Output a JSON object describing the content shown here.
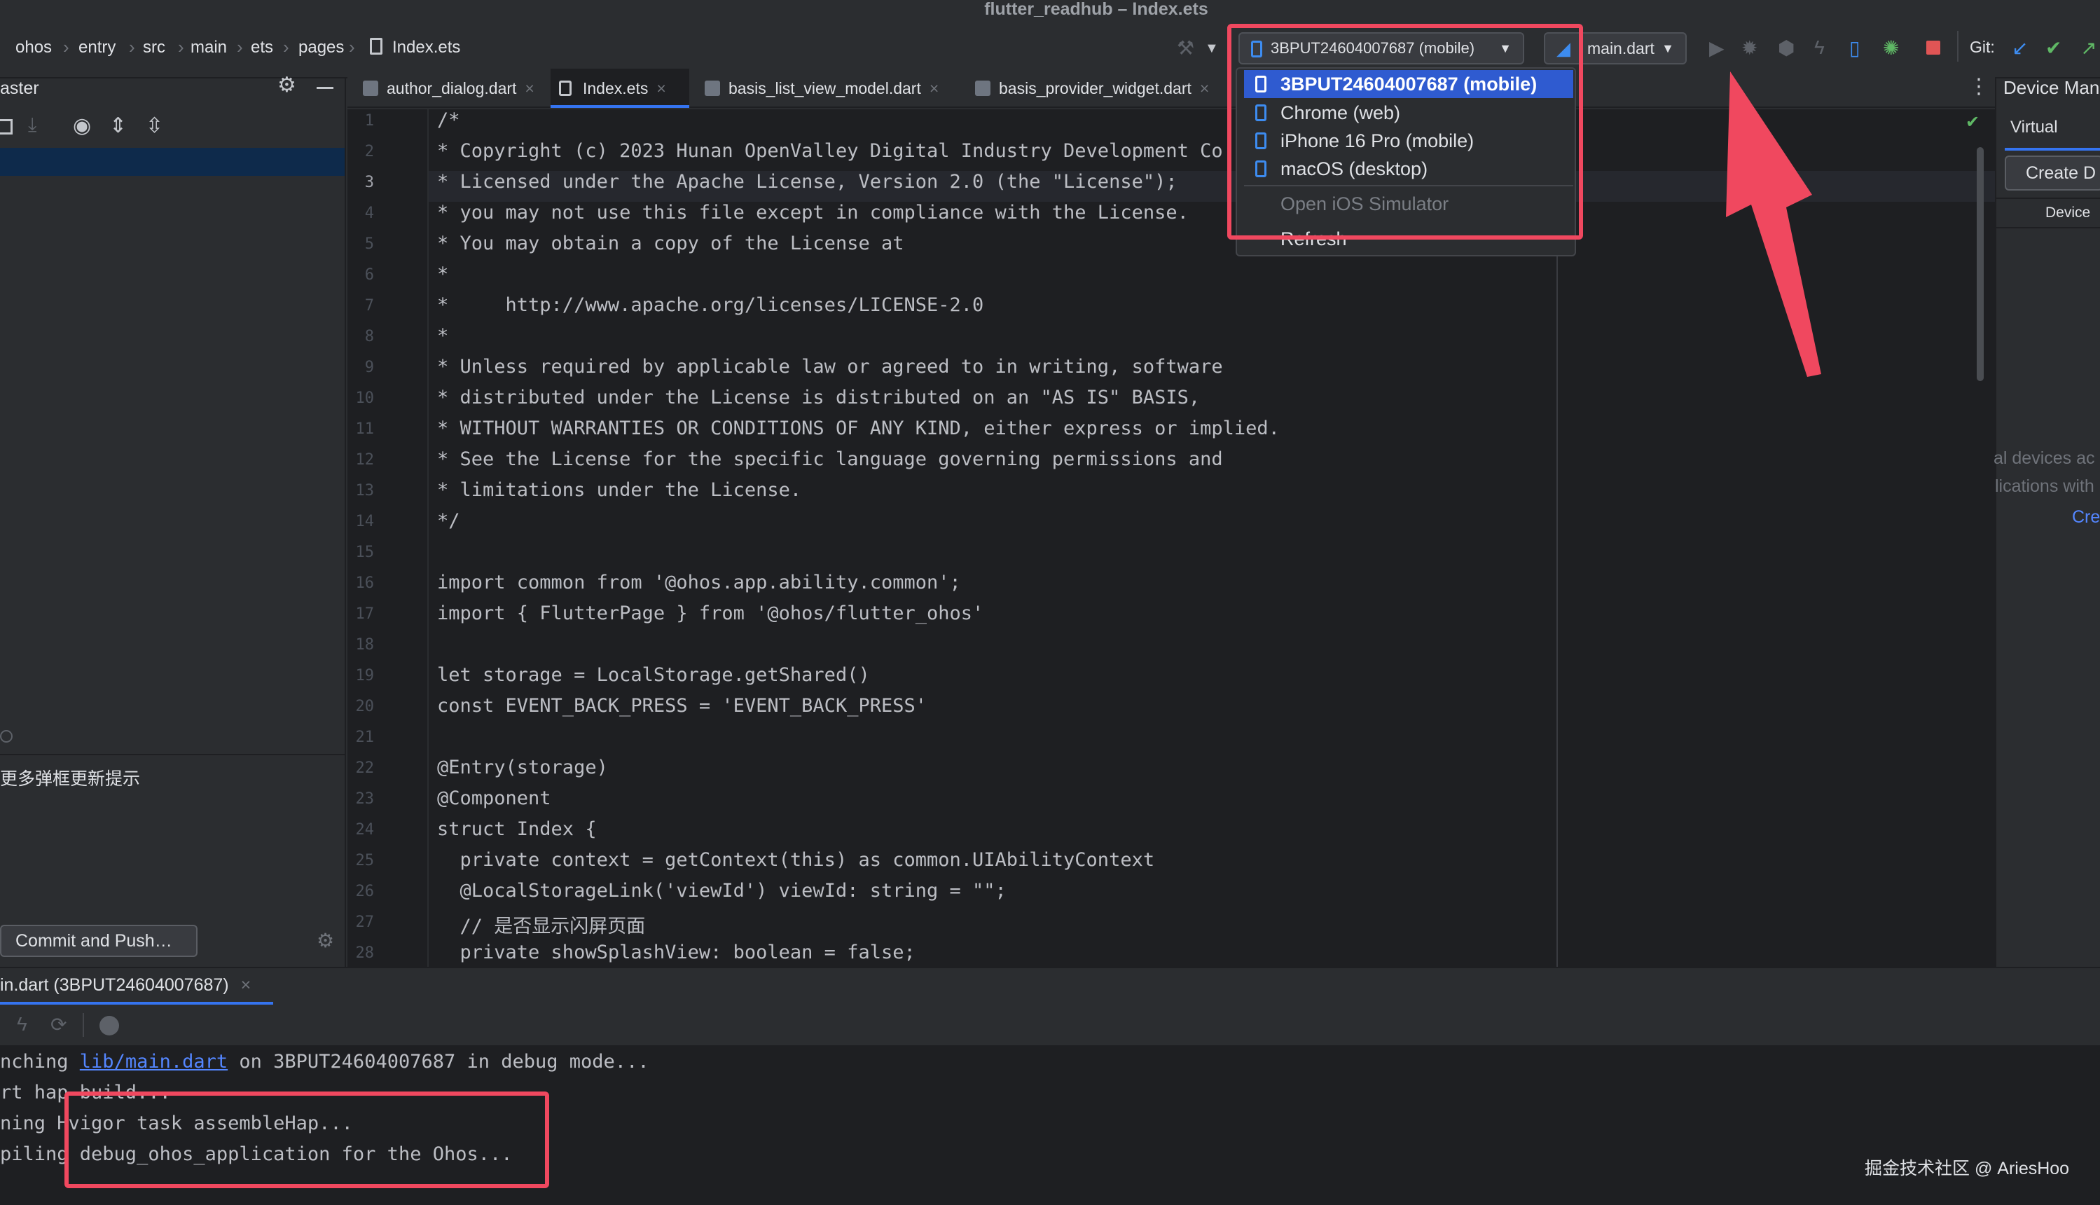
{
  "window": {
    "title": "flutter_readhub – Index.ets"
  },
  "breadcrumb": [
    "ohos",
    "entry",
    "src",
    "main",
    "ets",
    "pages",
    "Index.ets"
  ],
  "toolbar": {
    "device_selected": "3BPUT24604007687 (mobile)",
    "run_config": "main.dart",
    "git_label": "Git:"
  },
  "left_panel": {
    "branch_text": "aster",
    "commit_message_text": "更多弹框更新提示",
    "commit_button": "Commit and Push…"
  },
  "tabs": [
    {
      "label": "author_dialog.dart"
    },
    {
      "label": "Index.ets"
    },
    {
      "label": "basis_list_view_model.dart"
    },
    {
      "label": "basis_provider_widget.dart"
    }
  ],
  "device_menu": {
    "items": [
      "3BPUT24604007687 (mobile)",
      "Chrome (web)",
      "iPhone 16 Pro (mobile)",
      "macOS (desktop)"
    ],
    "open_simulator": "Open iOS Simulator",
    "refresh": "Refresh"
  },
  "editor": {
    "line_numbers": [
      "1",
      "2",
      "3",
      "4",
      "5",
      "6",
      "7",
      "8",
      "9",
      "10",
      "11",
      "12",
      "13",
      "14",
      "15",
      "16",
      "17",
      "18",
      "19",
      "20",
      "21",
      "22",
      "23",
      "24",
      "25",
      "26",
      "27",
      "28"
    ],
    "lines": [
      "/*",
      "* Copyright (c) 2023 Hunan OpenValley Digital Industry Development Co.,",
      "* Licensed under the Apache License, Version 2.0 (the \"License\");",
      "* you may not use this file except in compliance with the License.",
      "* You may obtain a copy of the License at",
      "*",
      "*     http://www.apache.org/licenses/LICENSE-2.0",
      "*",
      "* Unless required by applicable law or agreed to in writing, software",
      "* distributed under the License is distributed on an \"AS IS\" BASIS,",
      "* WITHOUT WARRANTIES OR CONDITIONS OF ANY KIND, either express or implied.",
      "* See the License for the specific language governing permissions and",
      "* limitations under the License.",
      "*/",
      "",
      "import common from '@ohos.app.ability.common';",
      "import { FlutterPage } from '@ohos/flutter_ohos'",
      "",
      "let storage = LocalStorage.getShared()",
      "const EVENT_BACK_PRESS = 'EVENT_BACK_PRESS'",
      "",
      "@Entry(storage)",
      "@Component",
      "struct Index {",
      "  private context = getContext(this) as common.UIAbilityContext",
      "  @LocalStorageLink('viewId') viewId: string = \"\";",
      "  // 是否显示闪屏页面",
      "  private showSplashView: boolean = false;"
    ]
  },
  "right_panel": {
    "title": "Device Man",
    "tab_virtual": "Virtual",
    "create_button": "Create D",
    "device_column": "Device",
    "empty_line1": "al devices ac",
    "empty_line2": "lications with",
    "create_link": "Cre"
  },
  "run_panel": {
    "tab_label": "in.dart (3BPUT24604007687)",
    "console": {
      "line1_prefix": "nching ",
      "line1_link": "lib/main.dart",
      "line1_suffix": " on 3BPUT24604007687 in debug mode...",
      "line2": "rt hap build...",
      "line3": "ning Hvigor task assembleHap...",
      "line4": "piling debug_ohos_application for the Ohos..."
    }
  },
  "watermark": "掘金技术社区 @ AriesHoo",
  "colors": {
    "accent": "#3574f0",
    "annotation_red": "#f0485f",
    "menu_selected": "#2f5bd0"
  }
}
